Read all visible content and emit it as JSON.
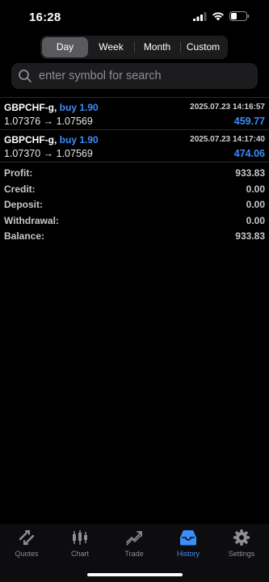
{
  "status": {
    "time": "16:28"
  },
  "period_tabs": [
    {
      "label": "Day",
      "active": true
    },
    {
      "label": "Week",
      "active": false
    },
    {
      "label": "Month",
      "active": false
    },
    {
      "label": "Custom",
      "active": false
    }
  ],
  "search": {
    "placeholder": "enter symbol for search"
  },
  "deals": [
    {
      "symbol": "GBPCHF-g,",
      "side": "buy 1.90",
      "datetime": "2025.07.23 14:16:57",
      "prices": "1.07376 → 1.07569",
      "profit": "459.77"
    },
    {
      "symbol": "GBPCHF-g,",
      "side": "buy 1.90",
      "datetime": "2025.07.23 14:17:40",
      "prices": "1.07370 → 1.07569",
      "profit": "474.06"
    }
  ],
  "summary": [
    {
      "label": "Profit:",
      "value": "933.83"
    },
    {
      "label": "Credit:",
      "value": "0.00"
    },
    {
      "label": "Deposit:",
      "value": "0.00"
    },
    {
      "label": "Withdrawal:",
      "value": "0.00"
    },
    {
      "label": "Balance:",
      "value": "933.83"
    }
  ],
  "tabbar": [
    {
      "label": "Quotes",
      "icon": "quotes-icon",
      "active": false
    },
    {
      "label": "Chart",
      "icon": "chart-icon",
      "active": false
    },
    {
      "label": "Trade",
      "icon": "trade-icon",
      "active": false
    },
    {
      "label": "History",
      "icon": "history-icon",
      "active": true
    },
    {
      "label": "Settings",
      "icon": "settings-icon",
      "active": false
    }
  ],
  "colors": {
    "accent": "#3d8dfb",
    "background": "#000000",
    "muted": "#8e8e93"
  }
}
